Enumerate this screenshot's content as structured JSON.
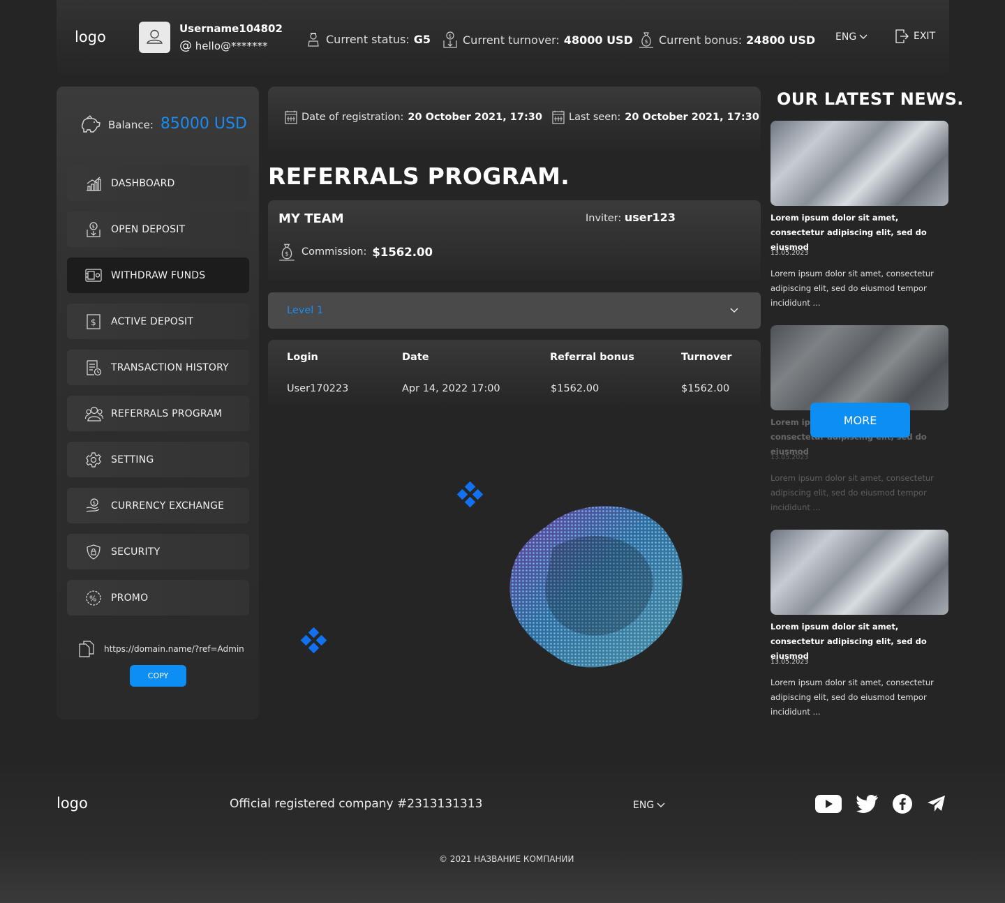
{
  "header": {
    "logo": "logo",
    "username": "Username104802",
    "email_prefix": "@",
    "email": "hello@*******",
    "status_label": "Current status:",
    "status_value": "G5",
    "turnover_label": "Current turnover:",
    "turnover_value": "48000 USD",
    "bonus_label": "Current bonus:",
    "bonus_value": "24800 USD",
    "language": "ENG",
    "exit_label": "EXIT"
  },
  "sidebar": {
    "balance_label": "Balance:",
    "balance_value": "85000 USD",
    "items": [
      {
        "label": "DASHBOARD",
        "icon": "chart-icon"
      },
      {
        "label": "OPEN DEPOSIT",
        "icon": "deposit-icon"
      },
      {
        "label": "WITHDRAW FUNDS",
        "icon": "withdraw-icon",
        "active": true
      },
      {
        "label": "ACTIVE DEPOSIT",
        "icon": "dollar-box-icon"
      },
      {
        "label": "TRANSACTION HISTORY",
        "icon": "history-icon"
      },
      {
        "label": "REFERRALS PROGRAM",
        "icon": "users-icon"
      },
      {
        "label": "SETTING",
        "icon": "gear-icon"
      },
      {
        "label": "CURRENCY EXCHANGE",
        "icon": "exchange-icon"
      },
      {
        "label": "SECURITY",
        "icon": "shield-icon"
      },
      {
        "label": "PROMO",
        "icon": "percent-icon"
      }
    ],
    "ref_link": "https://domain.name/?ref=Admin",
    "copy_label": "COPY"
  },
  "main": {
    "registration_label": "Date of registration:",
    "registration_value": "20 October 2021, 17:30",
    "last_seen_label": "Last seen:",
    "last_seen_value": "20 October 2021, 17:30",
    "title": "REFERRALS PROGRAM.",
    "team": {
      "title": "MY TEAM",
      "inviter_label": "Inviter:",
      "inviter_value": "user123",
      "commission_label": "Commission:",
      "commission_value": "$1562.00"
    },
    "level_select": "Level 1",
    "table": {
      "headers": [
        "Login",
        "Date",
        "Referral bonus",
        "Turnover"
      ],
      "rows": [
        [
          "User170223",
          "Apr 14, 2022 17:00",
          "$1562.00",
          "$1562.00"
        ]
      ]
    }
  },
  "news": {
    "title": "OUR LATEST NEWS.",
    "items": [
      {
        "headline": "Lorem ipsum dolor sit amet, consectetur adipiscing elit, sed do eiusmod",
        "date": "13.05.2023",
        "text": "Lorem ipsum dolor sit amet, consectetur adipiscing elit, sed do eiusmod tempor incididunt ..."
      },
      {
        "headline": "Lorem ipsum dolor sit amet, consectetur adipiscing elit, sed do eiusmod",
        "date": "13.05.2023",
        "text": "Lorem ipsum dolor sit amet, consectetur adipiscing elit, sed do eiusmod tempor incididunt ..."
      },
      {
        "headline": "Lorem ipsum dolor sit amet, consectetur adipiscing elit, sed do eiusmod",
        "date": "13.05.2023",
        "text": "Lorem ipsum dolor sit amet, consectetur adipiscing elit, sed do eiusmod tempor incididunt ..."
      }
    ],
    "more_label": "MORE"
  },
  "footer": {
    "logo": "logo",
    "company": "Official registered company #2313131313",
    "language": "ENG",
    "copyright": "© 2021 НАЗВАНИЕ КОМПАНИИ",
    "social": [
      "youtube-icon",
      "twitter-icon",
      "facebook-icon",
      "telegram-icon"
    ]
  },
  "colors": {
    "accent": "#0d8ef5",
    "background": "#252525",
    "panel": "#333333"
  }
}
